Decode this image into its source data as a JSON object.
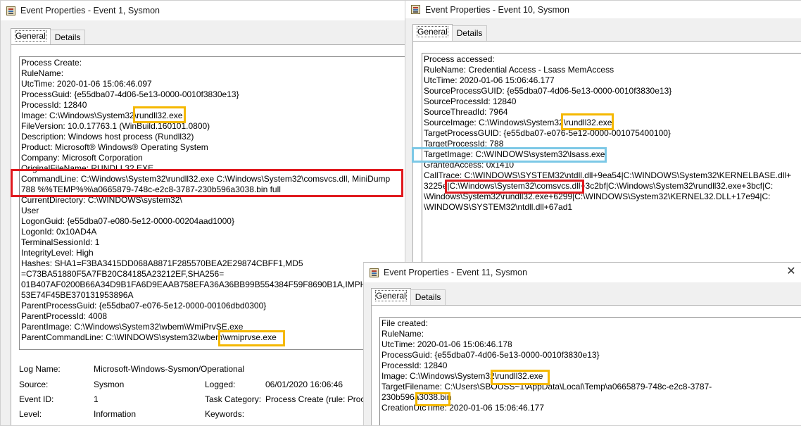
{
  "win1": {
    "title": "Event Properties - Event 1, Sysmon",
    "tabs": [
      "General",
      "Details"
    ],
    "lines": [
      "Process Create:",
      "RuleName:",
      "UtcTime: 2020-01-06 15:06:46.097",
      "ProcessGuid: {e55dba07-4d06-5e13-0000-0010f3830e13}",
      "ProcessId: 12840",
      "Image: C:\\Windows\\System32\\rundll32.exe",
      "FileVersion: 10.0.17763.1 (WinBuild.160101.0800)",
      "Description: Windows host process (Rundll32)",
      "Product: Microsoft® Windows® Operating System",
      "Company: Microsoft Corporation",
      "OriginalFileName: RUNDLL32.EXE",
      "CommandLine: C:\\Windows\\System32\\rundll32.exe C:\\Windows\\System32\\comsvcs.dll, MiniDump",
      "788 %%TEMP%%\\a0665879-748c-e2c8-3787-230b596a3038.bin full",
      "CurrentDirectory: C:\\WINDOWS\\system32\\",
      "User",
      "LogonGuid: {e55dba07-e080-5e12-0000-00204aad1000}",
      "LogonId: 0x10AD4A",
      "TerminalSessionId: 1",
      "IntegrityLevel: High",
      "Hashes: SHA1=F3BA3415DD068A8871F285570BEA2E29874CBFF1,MD5",
      "=C73BA51880F5A7FB20C84185A23212EF,SHA256=",
      "01B407AF0200B66A34D9B1FA6D9EAAB758EFA36A36BB99B554384F59F8690B1A,IMPHASH=F2",
      "53E74F45BE370131953896A",
      "ParentProcessGuid: {e55dba07-e076-5e12-0000-00106dbd0300}",
      "ParentProcessId: 4008",
      "ParentImage: C:\\Windows\\System32\\wbem\\WmiPrvSE.exe",
      "ParentCommandLine: C:\\WINDOWS\\system32\\wbem\\wmiprvse.exe"
    ],
    "meta": {
      "log_name_label": "Log Name:",
      "log_name_value": "Microsoft-Windows-Sysmon/Operational",
      "source_label": "Source:",
      "source_value": "Sysmon",
      "logged_label": "Logged:",
      "logged_value": "06/01/2020 16:06:46",
      "event_id_label": "Event ID:",
      "event_id_value": "1",
      "task_label": "Task Category:",
      "task_value": "Process Create (rule: Proce",
      "level_label": "Level:",
      "level_value": "Information",
      "keywords_label": "Keywords:"
    }
  },
  "win2": {
    "title": "Event Properties - Event 10, Sysmon",
    "tabs": [
      "General",
      "Details"
    ],
    "lines": [
      "Process accessed:",
      "RuleName: Credential Access - Lsass MemAccess",
      "UtcTime: 2020-01-06 15:06:46.177",
      "SourceProcessGUID: {e55dba07-4d06-5e13-0000-0010f3830e13}",
      "SourceProcessId: 12840",
      "SourceThreadId: 7964",
      "SourceImage: C:\\Windows\\System32\\rundll32.exe",
      "TargetProcessGUID: {e55dba07-e076-5e12-0000-001075400100}",
      "TargetProcessId: 788",
      "TargetImage: C:\\WINDOWS\\system32\\lsass.exe",
      "GrantedAccess: 0x1410",
      "CallTrace: C:\\WINDOWS\\SYSTEM32\\ntdll.dll+9ea54|C:\\WINDOWS\\System32\\KERNELBASE.dll+",
      "3225e|C:\\Windows\\System32\\comsvcs.dll+3c2bf|C:\\Windows\\System32\\rundll32.exe+3bcf|C:",
      "\\Windows\\System32\\rundll32.exe+6299|C:\\WINDOWS\\System32\\KERNEL32.DLL+17e94|C:",
      "\\WINDOWS\\SYSTEM32\\ntdll.dll+67ad1"
    ]
  },
  "win3": {
    "title": "Event Properties - Event 11, Sysmon",
    "tabs": [
      "General",
      "Details"
    ],
    "close_glyph": "✕",
    "lines": [
      "File created:",
      "RuleName:",
      "UtcTime: 2020-01-06 15:06:46.178",
      "ProcessGuid: {e55dba07-4d06-5e13-0000-0010f3830e13}",
      "ProcessId: 12840",
      "Image: C:\\Windows\\System32\\rundll32.exe",
      "TargetFilename: C:\\Users\\SBOUSS~1\\AppData\\Local\\Temp\\a0665879-748c-e2c8-3787-",
      "230b596a3038.bin",
      "CreationUtcTime: 2020-01-06 15:06:46.177"
    ]
  },
  "colors": {
    "highlight_yellow": "#f5b800",
    "highlight_red": "#e0191e",
    "highlight_blue": "#7cc8e6"
  }
}
